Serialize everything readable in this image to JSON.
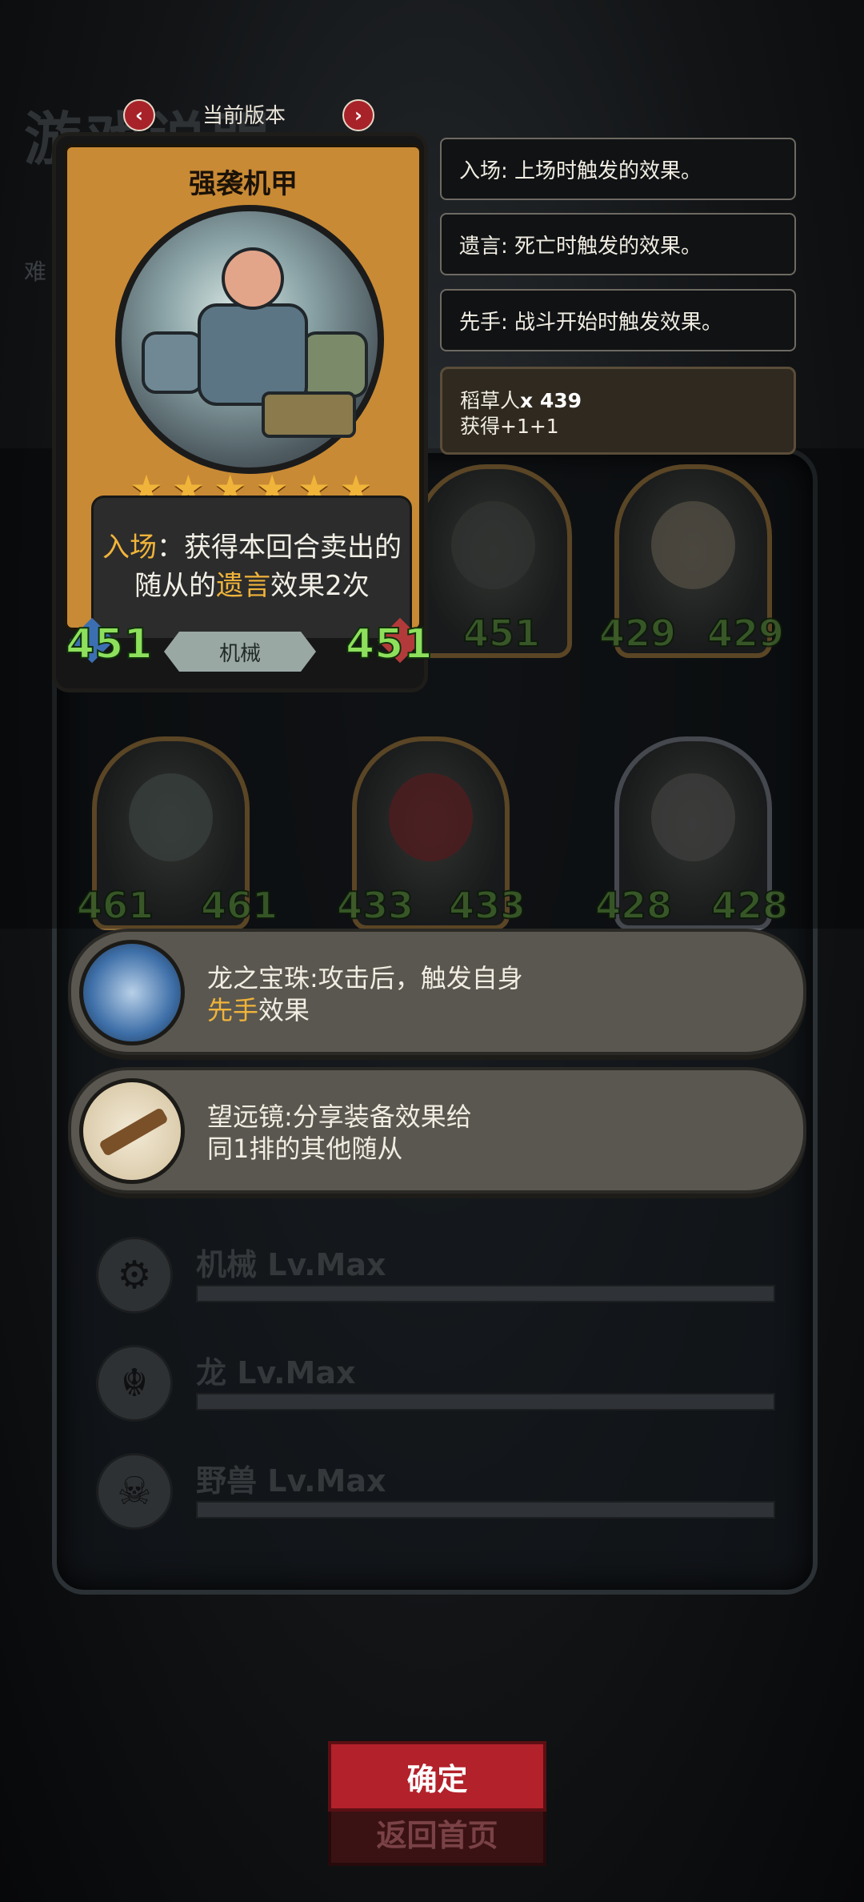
{
  "background": {
    "title": "游戏说明",
    "side_label": "难"
  },
  "version": {
    "label": "当前版本",
    "prev_icon": "chevron-left-icon",
    "next_icon": "chevron-right-icon"
  },
  "card": {
    "name": "强袭机甲",
    "stars": 6,
    "description_prefix": "入场",
    "description_mid": "：获得本回合卖出的随从的",
    "description_keyword": "遗言",
    "description_suffix": "效果2次",
    "attack": "451",
    "health": "451",
    "tribe": "机械"
  },
  "keywords": [
    {
      "text": "入场: 上场时触发的效果。"
    },
    {
      "text": "遗言: 死亡时触发的效果。"
    },
    {
      "text": "先手: 战斗开始时触发效果。"
    }
  ],
  "reward": {
    "line1_name": "稻草人",
    "line1_count": "x 439",
    "line2": "获得+1+1"
  },
  "minions": [
    {
      "attack": "",
      "health": "451"
    },
    {
      "attack": "429",
      "health": "429"
    },
    {
      "attack": "461",
      "health": "461"
    },
    {
      "attack": "433",
      "health": "433"
    },
    {
      "attack": "428",
      "health": "428"
    }
  ],
  "equipment": [
    {
      "name_text": "龙之宝珠:攻击后，触发自身",
      "keyword": "先手",
      "suffix": "效果",
      "icon": "dragon-orb-icon"
    },
    {
      "line1": "望远镜:分享装备效果给",
      "line2": "同1排的其他随从",
      "icon": "telescope-icon"
    }
  ],
  "tribes": [
    {
      "label": "机械 Lv.Max",
      "icon": "mech-icon"
    },
    {
      "label": "龙 Lv.Max",
      "icon": "dragon-icon"
    },
    {
      "label": "野兽 Lv.Max",
      "icon": "beast-icon"
    }
  ],
  "buttons": {
    "confirm": "确定",
    "home": "返回首页"
  },
  "colors": {
    "accent_gold": "#f0b43a",
    "stat_green": "#8ee05c",
    "confirm_red": "#b3212a"
  }
}
